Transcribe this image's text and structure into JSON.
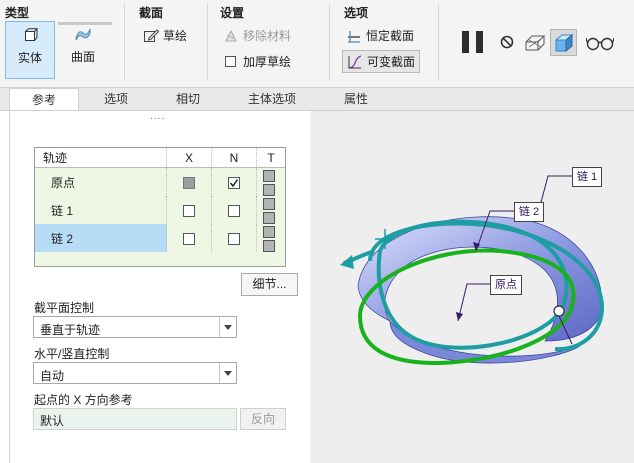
{
  "ribbon": {
    "type_group": {
      "title": "类型",
      "solid_label": "实体",
      "surface_label": "曲面"
    },
    "section_group": {
      "title": "截面",
      "sketch_label": "草绘"
    },
    "settings_group": {
      "title": "设置",
      "remove_material_label": "移除材料",
      "thicken_label": "加厚草绘"
    },
    "options_group": {
      "title": "选项",
      "constant_section_label": "恒定截面",
      "variable_section_label": "可变截面"
    }
  },
  "tabs": [
    "参考",
    "选项",
    "相切",
    "主体选项",
    "属性"
  ],
  "panel": {
    "grip": "....",
    "table": {
      "headers": [
        "轨迹",
        "X",
        "N",
        "T"
      ],
      "rows": [
        {
          "name": "原点",
          "x": "gray",
          "n": "checked",
          "t": true
        },
        {
          "name": "链 1",
          "x": "empty",
          "n": "empty",
          "t": true
        },
        {
          "name": "链 2",
          "x": "empty",
          "n": "empty",
          "t": true
        }
      ]
    },
    "details_button": "细节...",
    "section_plane_label": "截平面控制",
    "section_plane_value": "垂直于轨迹",
    "hv_control_label": "水平/竖直控制",
    "hv_control_value": "自动",
    "x_ref_label": "起点的 X 方向参考",
    "x_ref_value": "默认",
    "flip_button": "反向"
  },
  "viewport": {
    "labels": {
      "chain1": "链 1",
      "chain2": "链 2",
      "origin": "原点"
    },
    "colors": {
      "teal": "#1e9ea2",
      "green": "#19b21c",
      "surface": "#9aa6e6"
    }
  }
}
